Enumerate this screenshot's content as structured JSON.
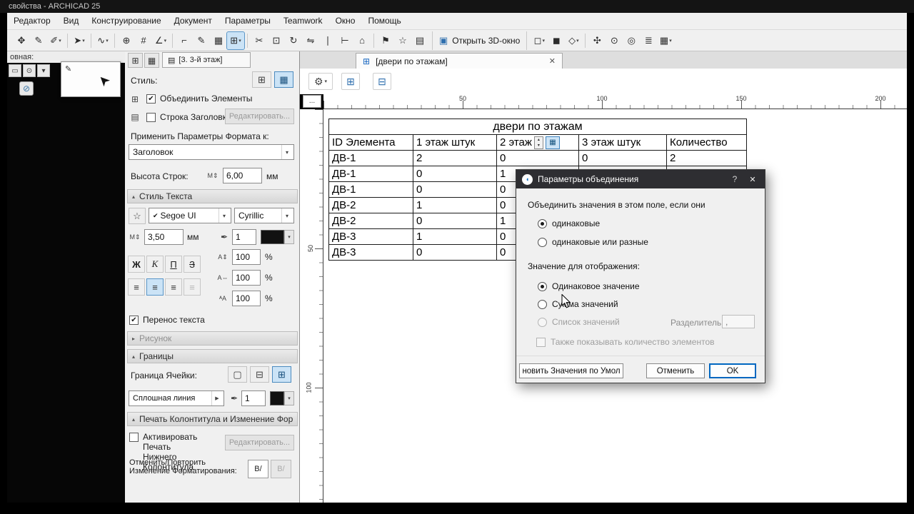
{
  "glyphs": {
    "caret": "▾",
    "chevron": "▾",
    "check": "✔",
    "gear": "⚙",
    "star": "☆",
    "pen": "✒",
    "size": "M⇕",
    "spin_up": "▴",
    "spin_down": "▾",
    "tri_up": "▴",
    "tri_right": "▸",
    "tri_play": "▶",
    "sp_height": "A⇕",
    "sp_width": "A⇔",
    "sp_factor": "ᴬA",
    "pencil": "✎",
    "big_arrow": "➤",
    "circle_slash": "⊘",
    "folder": "▤",
    "logo": "◖",
    "close": "✕"
  },
  "window": {
    "title": "свойства - ARCHICAD 25"
  },
  "menubar": {
    "items": [
      {
        "label": "Редактор"
      },
      {
        "label": "Вид"
      },
      {
        "label": "Конструирование"
      },
      {
        "label": "Документ"
      },
      {
        "label": "Параметры"
      },
      {
        "label": "Teamwork"
      },
      {
        "label": "Окно"
      },
      {
        "label": "Помощь"
      }
    ]
  },
  "toolbar": {
    "icons": [
      {
        "n": "pan-icon",
        "g": "✥"
      },
      {
        "n": "pencil-icon",
        "g": "✎"
      },
      {
        "n": "brush-icon",
        "g": "✐",
        "dd": 1
      },
      {
        "sep": 1
      },
      {
        "n": "arrow-tool-icon",
        "g": "➤",
        "dd": 1
      },
      {
        "sep": 1
      },
      {
        "n": "polyline-icon",
        "g": "∿",
        "dd": 1
      },
      {
        "sep": 1
      },
      {
        "n": "origin-icon",
        "g": "⊕"
      },
      {
        "n": "grid-snap-icon",
        "g": "#"
      },
      {
        "n": "guide-lines-icon",
        "g": "∠",
        "dd": 1
      },
      {
        "sep": 1
      },
      {
        "n": "dimension-icon",
        "g": "⌐"
      },
      {
        "n": "text-tool-icon",
        "g": "✎"
      },
      {
        "n": "marquee-icon",
        "g": "▦"
      },
      {
        "n": "schedule-view-icon",
        "g": "⊞",
        "active": 1,
        "dd": 1
      },
      {
        "sep": 1
      },
      {
        "n": "cut-icon",
        "g": "✂"
      },
      {
        "n": "copy-icon",
        "g": "⊡"
      },
      {
        "n": "rotate-icon",
        "g": "↻"
      },
      {
        "n": "mirror-icon",
        "g": "⇋"
      },
      {
        "n": "split-icon",
        "g": "∣"
      },
      {
        "n": "adjust-icon",
        "g": "⊢"
      },
      {
        "n": "home-story-icon",
        "g": "⌂"
      },
      {
        "sep": 1
      },
      {
        "n": "flag-icon",
        "g": "⚑"
      },
      {
        "n": "favorites-icon",
        "g": "☆"
      },
      {
        "n": "folder-icon",
        "g": "▤"
      }
    ],
    "open3d": {
      "label": "Открыть 3D-окно",
      "glyph": "▣"
    },
    "right_icons": [
      {
        "n": "front-view-icon",
        "g": "◻",
        "dd": 1
      },
      {
        "n": "solid-view-icon",
        "g": "◼"
      },
      {
        "n": "axonometry-icon",
        "g": "◇",
        "dd": 1
      },
      {
        "sep": 1
      },
      {
        "n": "walk-mode-icon",
        "g": "✣"
      },
      {
        "n": "zoom-icon",
        "g": "⊙"
      },
      {
        "n": "fit-view-icon",
        "g": "◎"
      },
      {
        "n": "layers-icon",
        "g": "≣"
      },
      {
        "n": "view-options-icon",
        "g": "▦",
        "dd": 1
      }
    ]
  },
  "left_dock": {
    "label": "овная:",
    "palette": [
      {
        "n": "window-select-icon",
        "g": "▭"
      },
      {
        "n": "zoom-mini-icon",
        "g": "⊙"
      },
      {
        "n": "dropdown-mini-icon",
        "g": "▾"
      }
    ]
  },
  "panel": {
    "tab_icons": [
      {
        "n": "scheme-settings-icon",
        "g": "⊞"
      },
      {
        "n": "fields-icon",
        "g": "▦"
      }
    ],
    "tab_label": "[3. 3-й этаж]",
    "style_label": "Стиль:",
    "style_icons": [
      {
        "n": "style-compact-icon",
        "g": "⊞"
      },
      {
        "n": "style-grid-icon",
        "g": "▦",
        "active": 1
      }
    ],
    "merge_row_icon": "⊞",
    "merge_elements_label": "Объединить Элементы",
    "header_row_icon": "▤",
    "header_row_label": "Строка Заголовка",
    "edit_label": "Редактировать...",
    "apply_label": "Применить Параметры Формата к:",
    "apply_value": "Заголовок",
    "row_height_label": "Высота Строк:",
    "row_height_value": "6,00",
    "unit_mm": "мм",
    "section_text_style": "Стиль Текста",
    "font_name": "Segoe UI",
    "font_script": "Cyrillic",
    "font_size": "3,50",
    "pen_weight": "1",
    "bold_label": "Ж",
    "italic_label": "К",
    "underline_label": "П",
    "strike_label": "З",
    "align_icons": [
      {
        "n": "align-left-icon",
        "g": "≡"
      },
      {
        "n": "align-center-icon",
        "g": "≡",
        "active": 1
      },
      {
        "n": "align-right-icon",
        "g": "≡"
      },
      {
        "n": "align-justify-icon",
        "g": "≡",
        "disabled": 1
      }
    ],
    "pct1": "100",
    "pct2": "100",
    "pct3": "100",
    "percent": "%",
    "wrap_label": "Перенос текста",
    "section_picture": "Рисунок",
    "section_borders": "Границы",
    "cell_border_label": "Граница Ячейки:",
    "border_icons": [
      {
        "n": "border-none-icon",
        "g": "▢"
      },
      {
        "n": "border-horizontal-icon",
        "g": "⊟"
      },
      {
        "n": "border-all-icon",
        "g": "⊞",
        "active": 1
      }
    ],
    "line_type_value": "Сплошная линия",
    "border_pen": "1",
    "section_footer": "Печать Колонтитула и Изменение Фор...",
    "footer_chk_line1": "Активировать Печать",
    "footer_chk_line2": "Нижнего Колонтитула",
    "undo_line1": "Отменить/Повторить",
    "undo_line2": "Изменение Форматирования:",
    "undo_btn": "B/"
  },
  "tabs": {
    "icon_glyph": "⊞",
    "label": "[двери по этажам]"
  },
  "viewbar": {
    "buttons": [
      {
        "n": "rebuild-from-model-icon",
        "g": "⊞"
      },
      {
        "n": "apply-to-model-icon",
        "g": "⊟"
      }
    ]
  },
  "ruler": {
    "corner": "...",
    "h_marks": [
      "50",
      "100",
      "150",
      "200"
    ],
    "v_marks": [
      "50",
      "100"
    ]
  },
  "schedule": {
    "title": "двери по этажам",
    "columns": [
      "ID Элемента",
      "1 этаж штук",
      "2 этаж",
      "3 этаж штук",
      "Количество"
    ],
    "flag_glyph": "▦",
    "rows": [
      [
        "ДВ-1",
        "2",
        "0",
        "0",
        "2"
      ],
      [
        "ДВ-1",
        "0",
        "1",
        "",
        ""
      ],
      [
        "ДВ-1",
        "0",
        "0",
        "",
        ""
      ],
      [
        "ДВ-2",
        "1",
        "0",
        "",
        ""
      ],
      [
        "ДВ-2",
        "0",
        "1",
        "",
        ""
      ],
      [
        "ДВ-3",
        "1",
        "0",
        "",
        ""
      ],
      [
        "ДВ-3",
        "0",
        "0",
        "",
        ""
      ]
    ]
  },
  "dialog": {
    "title": "Параметры объединения",
    "help_glyph": "?",
    "close_glyph": "✕",
    "merge_condition_label": "Объединить значения в этом поле, если они",
    "radio_same": "одинаковые",
    "radio_same_or_diff": "одинаковые или разные",
    "display_value_label": "Значение для отображения:",
    "radio_same_value": "Одинаковое значение",
    "radio_sum": "Сумма значений",
    "radio_list": "Список значений",
    "separator_label": "Разделитель",
    "separator_value": ",",
    "show_count_label": "Также показывать количество элементов",
    "btn_update": "новить Значения по Умол",
    "btn_cancel": "Отменить",
    "btn_ok": "OK"
  }
}
